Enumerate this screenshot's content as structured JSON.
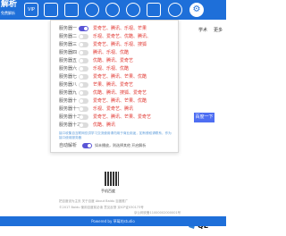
{
  "logo": {
    "main": "解析",
    "sub": "免费解析"
  },
  "top_icons": [
    {
      "name": "vip-icon",
      "text": "VIP"
    },
    {
      "name": "media-icon",
      "text": ""
    },
    {
      "name": "search-icon",
      "text": ""
    },
    {
      "name": "link-icon",
      "text": ""
    },
    {
      "name": "music-icon",
      "text": ""
    },
    {
      "name": "video-icon",
      "text": ""
    },
    {
      "name": "download-icon",
      "text": ""
    },
    {
      "name": "ad-icon",
      "text": ""
    },
    {
      "name": "gear-icon",
      "text": "⚙"
    }
  ],
  "panel": {
    "servers": [
      {
        "label": "服务器一",
        "on": true,
        "sites": "爱奇艺、腾讯、乐视、芒果"
      },
      {
        "label": "服务器二",
        "on": false,
        "sites": "乐视、爱奇艺、优酷、腾讯、"
      },
      {
        "label": "服务器三",
        "on": false,
        "sites": "爱奇艺、腾讯、乐视、搜狐"
      },
      {
        "label": "服务器四",
        "on": false,
        "sites": "腾讯、乐视、优酷"
      },
      {
        "label": "服务器五",
        "on": false,
        "sites": "优酷、腾讯、爱奇艺"
      },
      {
        "label": "服务器六",
        "on": false,
        "sites": "乐视、乐视、优酷"
      },
      {
        "label": "服务器七",
        "on": false,
        "sites": "爱奇艺、腾讯、芒果、优酷"
      },
      {
        "label": "服务器八",
        "on": false,
        "sites": "芒果、腾讯、爱奇艺"
      },
      {
        "label": "服务器九",
        "on": false,
        "sites": "优酷、腾讯、搜狐、爱奇艺"
      },
      {
        "label": "服务器十",
        "on": false,
        "sites": "爱奇艺、腾讯、芒果、优酷"
      },
      {
        "label": "服务器十一",
        "on": false,
        "sites": "乐视、爱奇艺、腾讯"
      },
      {
        "label": "服务器十二",
        "on": false,
        "sites": "爱奇艺、腾讯、芒果、爱奇艺"
      },
      {
        "label": "服务器十三",
        "on": false,
        "sites": "优酷、腾讯"
      }
    ],
    "note": "接口收集自互联网仅供学习交流使用请勿用于商业用途，如有侵权请联系，作为接口使用服务器",
    "auto_label": "自动解析",
    "auto_on": true,
    "auto_desc": "如未播放，则选择其他 开启解析"
  },
  "background": {
    "right_labels": [
      "学术",
      "更多"
    ],
    "search_button": "百度一下",
    "qr_label": "手机百度",
    "footer_lines": [
      "把百度设为主页    关于百度    About Baidu    百度推广",
      "©2017 Baidu 使用百度前必读 意见反馈 京ICP证030173号",
      "京公网安备11000002000001号"
    ],
    "watermark": "QL",
    "bottom_bar": "Powered by 草莓的studio"
  }
}
